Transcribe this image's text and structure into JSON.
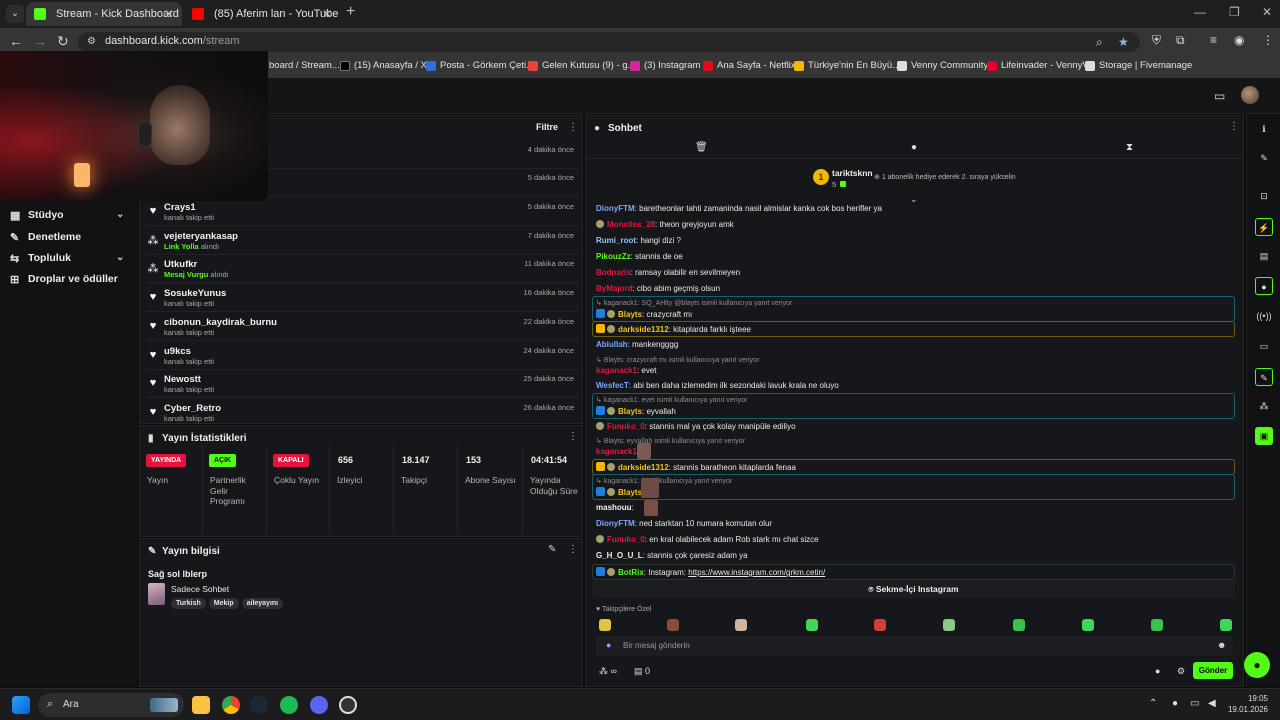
{
  "browser": {
    "tabs": [
      {
        "title": "Stream - Kick Dashboard",
        "favicon_color": "#53fc18"
      },
      {
        "title": "(85) Aferim lan - YouTube",
        "favicon_color": "#ff0000"
      }
    ],
    "url_host": "dashboard.kick.com",
    "url_path": "/stream",
    "bookmarks": [
      {
        "label": "board / Stream...",
        "color": "#53fc18"
      },
      {
        "label": "(15) Anasayfa / X",
        "color": "#ffffff"
      },
      {
        "label": "Posta - Görkem Çeti...",
        "color": "#2f6fdc"
      },
      {
        "label": "Gelen Kutusu (9) - g...",
        "color": "#ea4335"
      },
      {
        "label": "(3) Instagram",
        "color": "#d6249f"
      },
      {
        "label": "Ana Sayfa - Netflix",
        "color": "#e50914"
      },
      {
        "label": "Türkiye'nin En Büyü...",
        "color": "#f5b700"
      },
      {
        "label": "Venny Community",
        "color": "#ffffff"
      },
      {
        "label": "Lifeinvader - VennyV",
        "color": "#e4002b"
      },
      {
        "label": "Storage | Fivemanage",
        "color": "#ffffff"
      }
    ]
  },
  "sidebar": {
    "items": [
      {
        "label": "Stüdyo",
        "icon": "studio-icon",
        "expandable": true
      },
      {
        "label": "Denetleme",
        "icon": "wrench-icon",
        "expandable": false
      },
      {
        "label": "Topluluk",
        "icon": "community-icon",
        "expandable": true
      },
      {
        "label": "Droplar ve ödüller",
        "icon": "gift-icon",
        "expandable": false
      }
    ]
  },
  "activity": {
    "filter_label": "Filtre",
    "partial_rows": [
      {
        "time": "4 dakika önce"
      },
      {
        "time": "5 dakika önce"
      }
    ],
    "rows": [
      {
        "name": "Crays1",
        "sub": "kanalı takip etti",
        "time": "5 dakika önce",
        "icon": "heart-icon"
      },
      {
        "name": "vejeteryankasap",
        "highlight": "Link Yolla",
        "sub": "alındı",
        "time": "7 dakika önce",
        "icon": "redeem-icon"
      },
      {
        "name": "Utkufkr",
        "highlight": "Mesaj Vurgu",
        "sub": "alındı",
        "time": "11 dakika önce",
        "icon": "redeem-icon"
      },
      {
        "name": "SosukeYunus",
        "sub": "kanalı takip etti",
        "time": "16 dakika önce",
        "icon": "heart-icon"
      },
      {
        "name": "cibonun_kaydirak_burnu",
        "sub": "kanalı takip etti",
        "time": "22 dakika önce",
        "icon": "heart-icon"
      },
      {
        "name": "u9kcs",
        "sub": "kanalı takip etti",
        "time": "24 dakika önce",
        "icon": "heart-icon"
      },
      {
        "name": "Newostt",
        "sub": "kanalı takip etti",
        "time": "25 dakika önce",
        "icon": "heart-icon"
      },
      {
        "name": "Cyber_Retro",
        "sub": "kanalı takip etti",
        "time": "26 dakika önce",
        "icon": "heart-icon"
      }
    ]
  },
  "stats": {
    "title": "Yayın İstatistikleri",
    "columns": [
      {
        "badge": "YAYINDA",
        "badge_color": "#e5143f",
        "label": "Yayın"
      },
      {
        "badge": "AÇIK",
        "badge_color": "#53fc18",
        "label": "Partnerlik\nGelir\nProgramı"
      },
      {
        "badge": "KAPALI",
        "badge_color": "#e5143f",
        "label": "Çoklu Yayın"
      },
      {
        "value": "656",
        "label": "İzleyici"
      },
      {
        "value": "18.147",
        "label": "Takipçi"
      },
      {
        "value": "153",
        "label": "Abone Sayısı"
      },
      {
        "value": "04:41:54",
        "label": "Yayında\nOlduğu Süre"
      }
    ]
  },
  "stream_info": {
    "title": "Yayın bilgisi",
    "stream_title": "Sağ sol lblerp",
    "category": "Sadece Sohbet",
    "tags": [
      "Turkish",
      "Mekip",
      "aileyayını"
    ]
  },
  "chat": {
    "title": "Sohbet",
    "pinned_user": "tariktsknn",
    "pinned_count": "5",
    "pinned_rank": "1",
    "pinned_text": "1 abonelik hediye ederek 2. sıraya yükselin",
    "messages": [
      {
        "type": "msg",
        "user": "DionyFTM",
        "color": "#7aa8ff",
        "text": ": baretheonlar tahti zamaninda nasil almislar kanka cok bos herifler ya"
      },
      {
        "type": "msg",
        "user": "Monsties_28",
        "color": "#e5143f",
        "text": ": theon greyjoyun amk",
        "badge": true
      },
      {
        "type": "msg",
        "user": "Rumi_root",
        "color": "#8ec9ff",
        "text": ": hangi dizi ?"
      },
      {
        "type": "msg",
        "user": "PikouzZz",
        "color": "#53fc18",
        "text": ": stannis de oe"
      },
      {
        "type": "msg",
        "user": "Bodnaris",
        "color": "#e5143f",
        "text": ": ramsay olabilir en sevilmeyen"
      },
      {
        "type": "msg",
        "user": "ByMajord",
        "color": "#e5143f",
        "text": ": cibo abim geçmiş olsun"
      },
      {
        "type": "reply",
        "text": "kaganack1: SQ_AHlty @blayts isimli kullanıcıya yanıt veriyor"
      },
      {
        "type": "msg",
        "user": "Blayts",
        "color": "#f5c518",
        "text": ": crazycraft mı",
        "boxed": "#1b5e6e"
      },
      {
        "type": "msg",
        "user": "darkside1312",
        "color": "#f5c518",
        "text": ": kitaplarda farklı işteee",
        "boxed": "#6b5c14"
      },
      {
        "type": "msg",
        "user": "Abiullah",
        "color": "#7aa8ff",
        "text": ": mankengggg"
      },
      {
        "type": "reply",
        "text": "Blayts: crazycraft mı isimli kullanıcıya yanıt veriyor"
      },
      {
        "type": "msg",
        "user": "kaganack1",
        "color": "#e5143f",
        "text": ": evet"
      },
      {
        "type": "msg",
        "user": "WesfecT",
        "color": "#7aa8ff",
        "text": ": abi ben daha izlemedim ilk sezondaki lavuk krala ne oluyo"
      },
      {
        "type": "reply",
        "text": "kaganack1: evet isimli kullanıcıya yanıt veriyor"
      },
      {
        "type": "msg",
        "user": "Blayts",
        "color": "#f5c518",
        "text": ": eyvallah",
        "boxed": "#1b5e6e"
      },
      {
        "type": "msg",
        "user": "Funuko_0",
        "color": "#e5143f",
        "text": ": stannis mal ya çok kolay manipüle ediliyo",
        "badge": true
      },
      {
        "type": "reply",
        "text": "Blayts: eyvallah isimli kullanıcıya yanıt veriyor"
      },
      {
        "type": "msg",
        "user": "kaganack1",
        "color": "#e5143f",
        "text": ":"
      },
      {
        "type": "msg",
        "user": "darkside1312",
        "color": "#f5c518",
        "text": ": stannis baratheon kitaplarda fenaa",
        "boxed": "#6b5c14"
      },
      {
        "type": "reply",
        "text": "kaganack1: isimli kullanıcıya yanıt veriyor"
      },
      {
        "type": "msg",
        "user": "Blayts",
        "color": "#f5c518",
        "text": ":",
        "boxed": "#1b5e6e"
      },
      {
        "type": "msg",
        "user": "mashouu",
        "color": "#f0f0f0",
        "text": ":"
      },
      {
        "type": "msg",
        "user": "DionyFTM",
        "color": "#7aa8ff",
        "text": ": ned starktan 10 numara komutan olur"
      },
      {
        "type": "msg",
        "user": "Funuko_0",
        "color": "#e5143f",
        "text": ": en kral olabilecek adam Rob stark mı chat sizce",
        "badge": true
      },
      {
        "type": "msg",
        "user": "G_H_O_U_L",
        "color": "#f0f0f0",
        "text": ": stannis çok çaresiz adam ya"
      },
      {
        "type": "msg",
        "user": "BotRix",
        "color": "#53fc18",
        "text": ": Instagram: ",
        "link": "https://www.instagram.com/grkm.cetin/",
        "boxed": "#2a3a2a"
      }
    ],
    "tab_label": "Sekme-İçi Instagram",
    "followers_label": "Takipçilere Özel",
    "input_placeholder": "Bir mesaj gönderin",
    "send_label": "Gönder",
    "footer_count": "0",
    "footer_infinity": "∞"
  },
  "taskbar": {
    "search_label": "Ara",
    "time": "19:05",
    "date": "19.01.2026"
  }
}
